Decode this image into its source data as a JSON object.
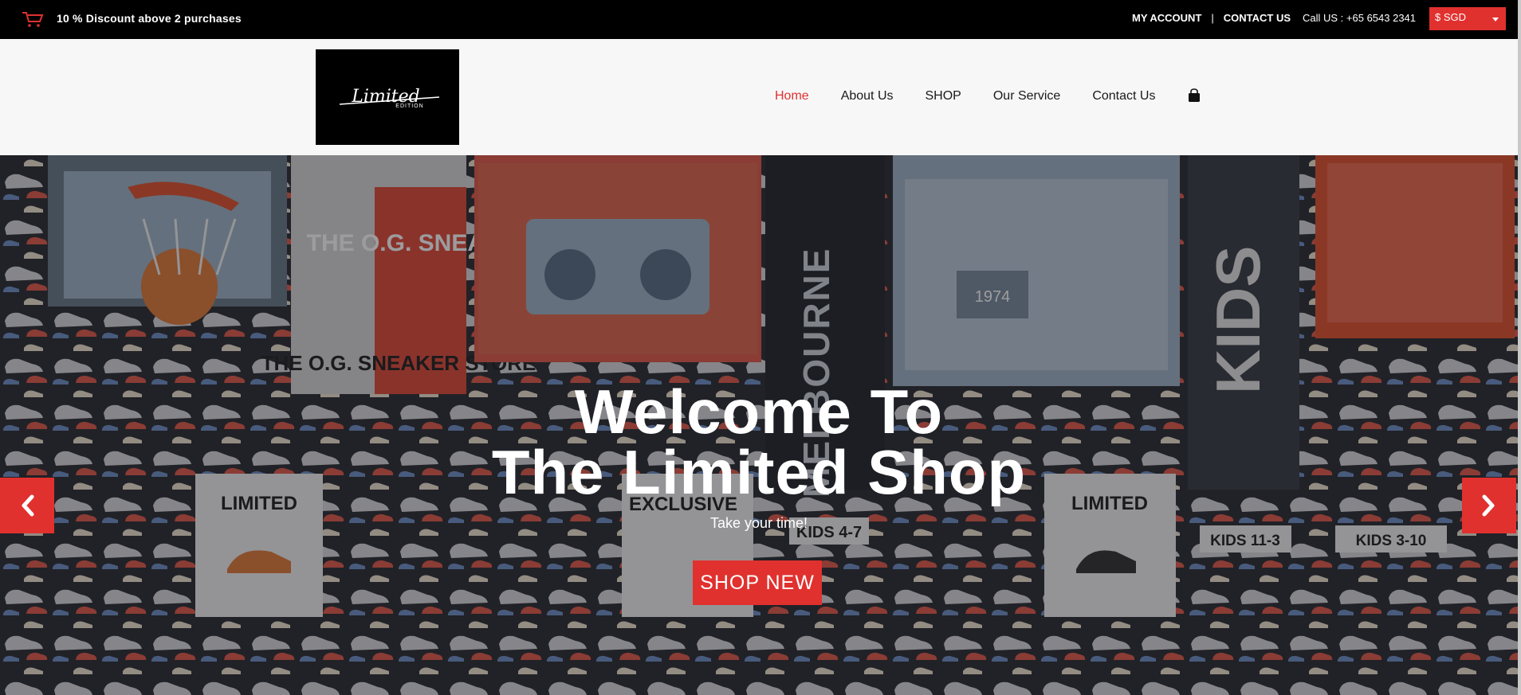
{
  "topbar": {
    "promo": "10 % Discount above 2 purchases",
    "my_account": "MY ACCOUNT",
    "separator": "|",
    "contact_us": "CONTACT US",
    "call": "Call US : +65 6543 2341",
    "currency": "$ SGD"
  },
  "header": {
    "logo_text": "Limited",
    "logo_subtext": "EDITION",
    "nav": {
      "home": "Home",
      "about": "About Us",
      "shop": "SHOP",
      "service": "Our Service",
      "contact": "Contact Us"
    }
  },
  "hero": {
    "title_line1": "Welcome To",
    "title_line2": "The Limited Shop",
    "subtitle": "Take your time!",
    "button": "SHOP NEW",
    "bg_signs": {
      "sneaker1": "THE O.G. SNEAKER",
      "sneaker2": "THE O.G. SNEAKER STORE",
      "melbourne": "MELBOURNE",
      "kids": "KIDS",
      "year": "1974",
      "limited_left": "LIMITED",
      "exclusive": "EXCLUSIVE",
      "kids_size1": "KIDS 4-7",
      "limited_right": "LIMITED",
      "kids_size2": "KIDS 11-3",
      "kids_size3": "KIDS 3-10"
    }
  },
  "colors": {
    "accent": "#e0312f",
    "topbar_bg": "#000000",
    "header_bg": "#f7f7f8"
  },
  "icons": [
    "cart-icon",
    "chevron-down-icon",
    "shopping-bag-icon",
    "chevron-left-icon",
    "chevron-right-icon"
  ]
}
